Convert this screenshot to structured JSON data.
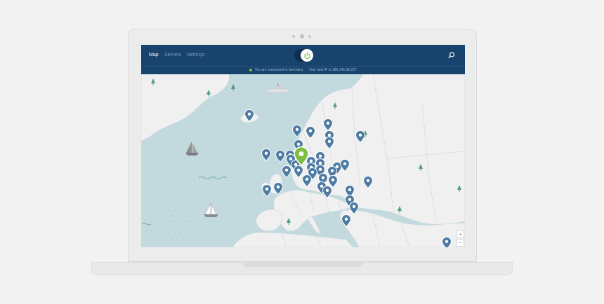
{
  "tabs": [
    {
      "label": "Map",
      "active": true
    },
    {
      "label": "Servers",
      "active": false
    },
    {
      "label": "Settings",
      "active": false
    }
  ],
  "status": {
    "connected_text": "You are connected to Germany.",
    "ip_text": "Your new IP is 185.145.38.227"
  },
  "zoom": {
    "in": "+",
    "out": "−"
  },
  "colors": {
    "header": "#17436d",
    "sea": "#c2dade",
    "land": "#f0f0f0",
    "pin": "#4d7aa3",
    "active_pin": "#7cc043"
  },
  "icons": {
    "power": "power-icon",
    "search": "search-icon",
    "pin": "location-pin-icon"
  }
}
